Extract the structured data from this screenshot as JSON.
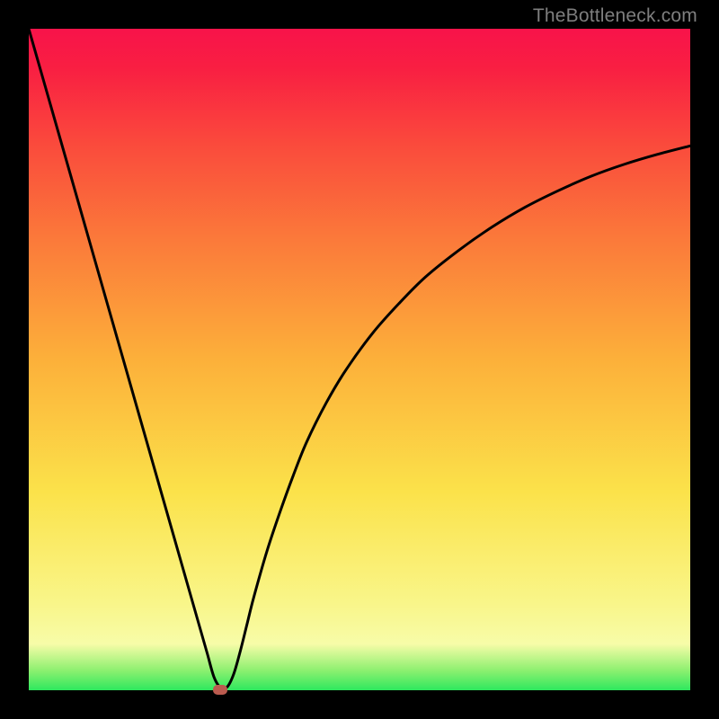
{
  "attribution": "TheBottleneck.com",
  "chart_data": {
    "type": "line",
    "title": "",
    "xlabel": "",
    "ylabel": "",
    "xlim": [
      0,
      100
    ],
    "ylim": [
      0,
      100
    ],
    "grid": false,
    "legend": false,
    "series": [
      {
        "name": "bottleneck-curve",
        "x": [
          0,
          2,
          4,
          6,
          8,
          10,
          12,
          14,
          16,
          18,
          20,
          22,
          24,
          26,
          27,
          28,
          29,
          30,
          31,
          32,
          33,
          34,
          36,
          38,
          40,
          42,
          45,
          48,
          52,
          56,
          60,
          65,
          70,
          75,
          80,
          85,
          90,
          95,
          100
        ],
        "y": [
          100,
          93,
          86,
          79,
          72,
          65,
          58,
          51,
          44,
          37,
          30,
          23,
          16,
          9,
          5.5,
          2,
          0.4,
          0.5,
          2.5,
          6,
          10,
          14,
          21,
          27,
          32.5,
          37.5,
          43.5,
          48.5,
          54,
          58.5,
          62.5,
          66.5,
          70,
          73,
          75.5,
          77.7,
          79.5,
          81,
          82.3
        ]
      }
    ],
    "marker": {
      "x": 29,
      "y": 0.2
    },
    "background_gradient": {
      "stops": [
        {
          "pos": 0.0,
          "color": "#2ee85e"
        },
        {
          "pos": 0.03,
          "color": "#8df070"
        },
        {
          "pos": 0.07,
          "color": "#f7fca8"
        },
        {
          "pos": 0.13,
          "color": "#f9f68a"
        },
        {
          "pos": 0.3,
          "color": "#fbe24a"
        },
        {
          "pos": 0.5,
          "color": "#fcb03a"
        },
        {
          "pos": 0.68,
          "color": "#fb7a3a"
        },
        {
          "pos": 0.82,
          "color": "#fa4c3c"
        },
        {
          "pos": 0.94,
          "color": "#f91f42"
        },
        {
          "pos": 1.0,
          "color": "#f8134a"
        }
      ]
    }
  }
}
